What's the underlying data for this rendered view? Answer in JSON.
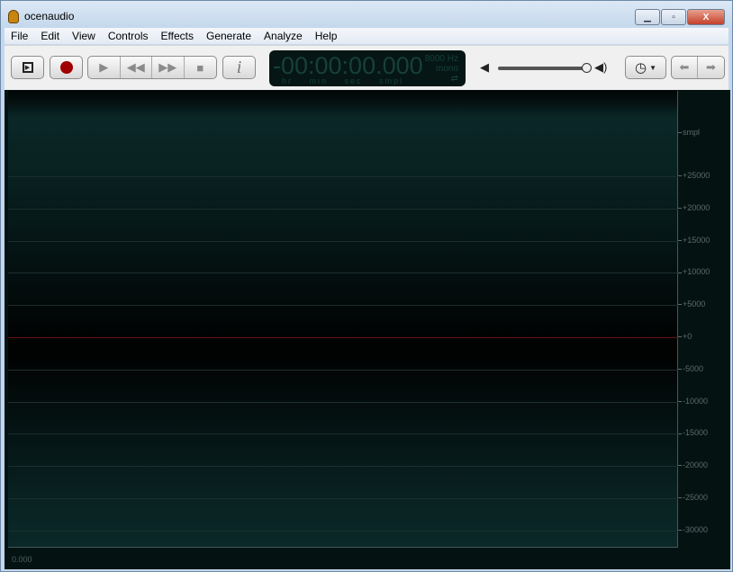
{
  "window": {
    "title": "ocenaudio",
    "min": "▁",
    "max": "▫",
    "close": "X"
  },
  "menu": [
    "File",
    "Edit",
    "View",
    "Controls",
    "Effects",
    "Generate",
    "Analyze",
    "Help"
  ],
  "display": {
    "time": "-00:00:00.000",
    "rate": "8000 Hz",
    "channels": "mono",
    "units": "hr min sec smpl"
  },
  "volume": {
    "level": 0.95
  },
  "scale": {
    "unit": "smpl",
    "ticks": [
      "+25000",
      "+20000",
      "+15000",
      "+10000",
      "+5000",
      "+0",
      "-5000",
      "-10000",
      "-15000",
      "-20000",
      "-25000",
      "-30000"
    ]
  },
  "timeline": {
    "start": "0.000"
  },
  "colors": {
    "zero_line": "#6a1010",
    "record": "#a00000"
  }
}
